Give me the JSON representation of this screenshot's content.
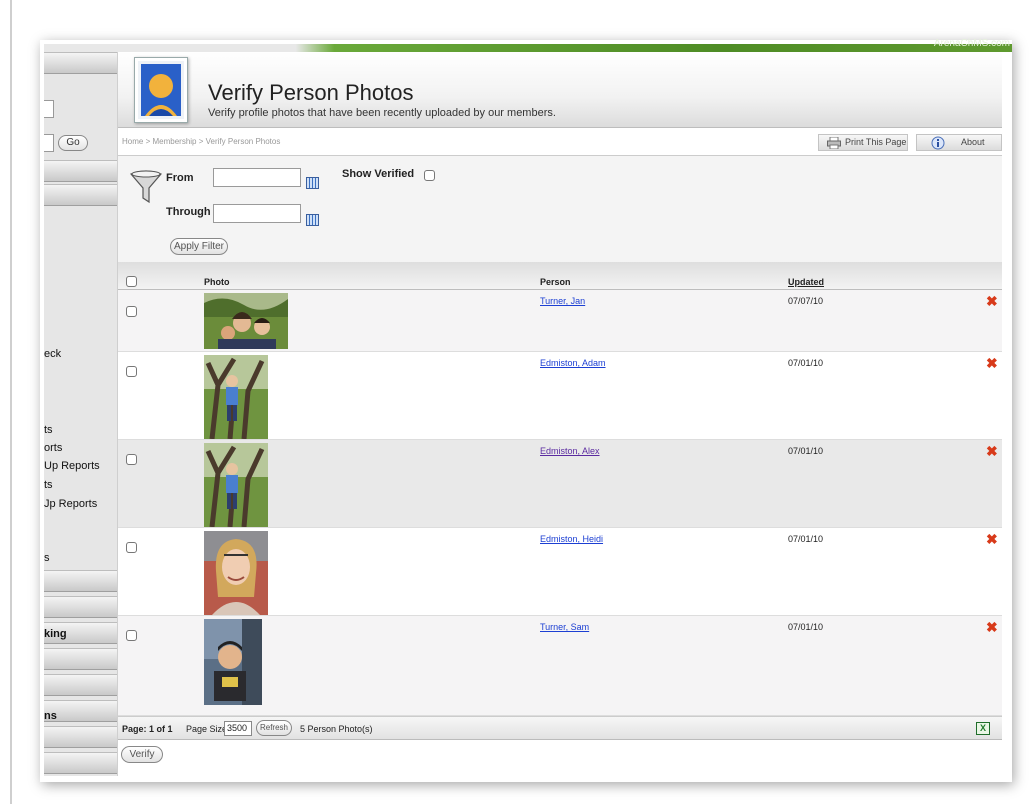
{
  "brand": "ArenaChMS.com",
  "sidebar": {
    "go_label": "Go",
    "items": [
      "eck",
      "ts",
      "orts",
      "Up Reports",
      "ts",
      "Jp Reports",
      "s"
    ],
    "sections": [
      "king",
      "ns"
    ]
  },
  "header": {
    "title": "Verify Person Photos",
    "subtitle": "Verify profile photos that have been recently uploaded by our members."
  },
  "breadcrumb": {
    "items": [
      "Home",
      "Membership",
      "Verify Person Photos"
    ],
    "separator": ">"
  },
  "toolbar": {
    "print_label": "Print This Page",
    "about_label": "About"
  },
  "filter": {
    "from_label": "From",
    "through_label": "Through",
    "show_verified_label": "Show Verified",
    "from_value": "",
    "through_value": "",
    "apply_label": "Apply Filter"
  },
  "grid": {
    "columns": {
      "photo": "Photo",
      "person": "Person",
      "updated": "Updated"
    },
    "rows": [
      {
        "person": "Turner, Jan",
        "updated": "07/07/10",
        "visited": false,
        "photo": "family-photo"
      },
      {
        "person": "Edmiston, Adam",
        "updated": "07/01/10",
        "visited": false,
        "photo": "child-on-tree-photo"
      },
      {
        "person": "Edmiston, Alex",
        "updated": "07/01/10",
        "visited": true,
        "photo": "child-on-tree-photo"
      },
      {
        "person": "Edmiston, Heidi",
        "updated": "07/01/10",
        "visited": false,
        "photo": "woman-portrait-photo"
      },
      {
        "person": "Turner, Sam",
        "updated": "07/01/10",
        "visited": false,
        "photo": "boy-portrait-photo"
      }
    ],
    "delete_symbol": "✖"
  },
  "pager": {
    "page_label": "Page: 1 of 1",
    "page_size_label": "Page Size:",
    "page_size_value": "3500",
    "refresh_label": "Refresh",
    "count_label": "5 Person Photo(s)"
  },
  "actions": {
    "verify_label": "Verify"
  },
  "colors": {
    "accent_green": "#4e8c25",
    "link": "#1c3fd3",
    "visited_link": "#5a2aa0",
    "delete": "#d83a1a"
  }
}
